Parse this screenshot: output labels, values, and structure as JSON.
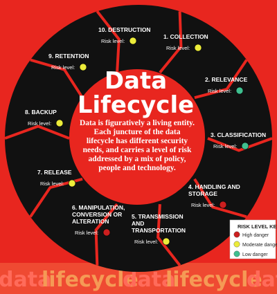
{
  "center": {
    "title_line1": "Data",
    "title_line2": "Lifecycle",
    "body_lines": [
      "Data is figuratively a living entity.",
      "Each juncture of the data",
      "lifecycle has different security",
      "needs, and carries a level of risk",
      "addressed by a mix of policy,",
      "people and technology."
    ]
  },
  "risk_label_text": "Risk level:",
  "stages": [
    {
      "title_lines": [
        "1. COLLECTION"
      ],
      "risk": "moderate"
    },
    {
      "title_lines": [
        "2. RELEVANCE"
      ],
      "risk": "low"
    },
    {
      "title_lines": [
        "3. CLASSIFICATION"
      ],
      "risk": "low"
    },
    {
      "title_lines": [
        "4. HANDLING AND",
        "STORAGE"
      ],
      "risk": "high"
    },
    {
      "title_lines": [
        "5. TRANSMISSION",
        "AND",
        "TRANSPORTATION"
      ],
      "risk": "moderate"
    },
    {
      "title_lines": [
        "6. MANIPULATION,",
        "CONVERSION OR",
        "ALTERATION"
      ],
      "risk": "high"
    },
    {
      "title_lines": [
        "7. RELEASE"
      ],
      "risk": "moderate"
    },
    {
      "title_lines": [
        "8. BACKUP"
      ],
      "risk": "moderate"
    },
    {
      "title_lines": [
        "9. RETENTION"
      ],
      "risk": "moderate"
    },
    {
      "title_lines": [
        "10. DESTRUCTION"
      ],
      "risk": "moderate"
    }
  ],
  "risk_key": {
    "title": "RISK LEVEL KEY",
    "items": [
      {
        "level": "high",
        "label": "High danger"
      },
      {
        "level": "moderate",
        "label": "Moderate danger"
      },
      {
        "level": "low",
        "label": "Low danger"
      }
    ]
  },
  "colors": {
    "background": "#e8261f",
    "ring": "#111111",
    "center": "#e8261f",
    "high": "#cc1f1f",
    "moderate": "#ecec3a",
    "low": "#3fbf8f",
    "watermark_data": "#ff6b5a",
    "watermark_lifecycle": "#f59a55"
  },
  "watermark": [
    "data",
    "lifecycle",
    "data",
    "lifecycle",
    "data"
  ]
}
